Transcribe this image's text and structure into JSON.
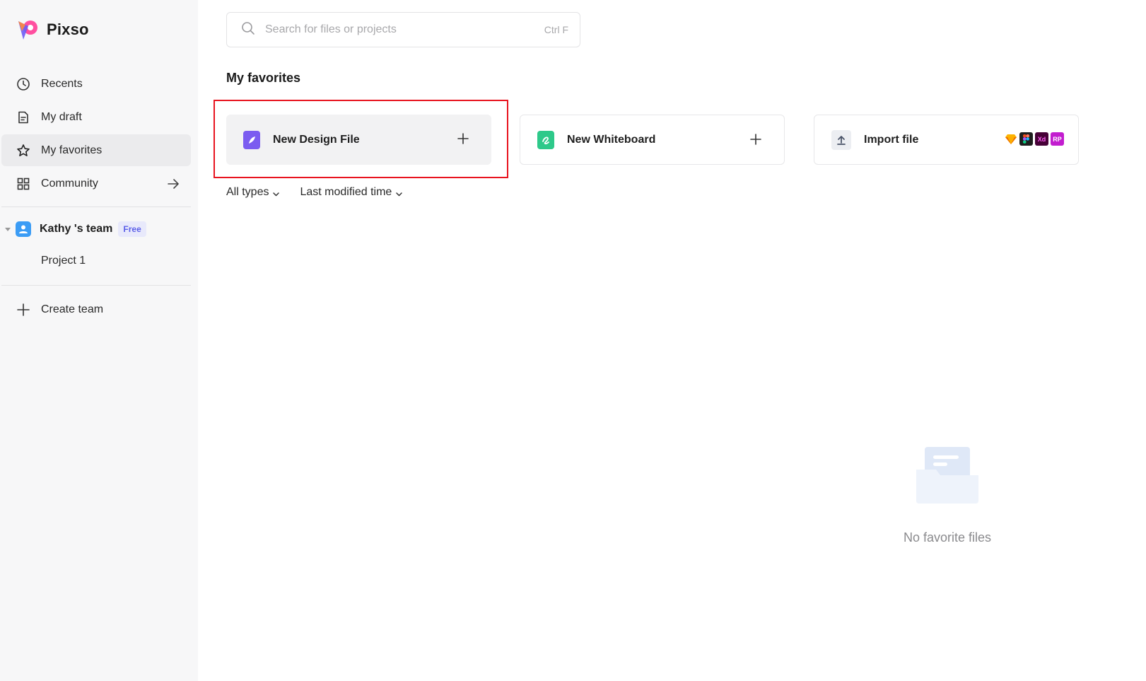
{
  "app": {
    "name": "Pixso"
  },
  "sidebar": {
    "nav": [
      {
        "label": "Recents",
        "icon": "clock-icon"
      },
      {
        "label": "My draft",
        "icon": "draft-document-icon"
      },
      {
        "label": "My favorites",
        "icon": "star-icon",
        "active": true
      },
      {
        "label": "Community",
        "icon": "grid-icon",
        "trailing_icon": "arrow-right-icon"
      }
    ],
    "team": {
      "name": "Kathy 's team",
      "badge": "Free",
      "projects": [
        {
          "label": "Project 1"
        }
      ]
    },
    "create_team_label": "Create team"
  },
  "search": {
    "placeholder": "Search for files or projects",
    "shortcut": "Ctrl F"
  },
  "main": {
    "section_title": "My favorites",
    "cards": [
      {
        "label": "New Design File",
        "icon": "design-file-icon",
        "action_icon": "plus-icon"
      },
      {
        "label": "New Whiteboard",
        "icon": "whiteboard-icon",
        "action_icon": "plus-icon"
      },
      {
        "label": "Import file",
        "icon": "upload-icon",
        "formats": [
          "Sketch",
          "Figma",
          "Xd",
          "RP"
        ]
      }
    ],
    "filters": [
      {
        "label": "All types"
      },
      {
        "label": "Last modified time"
      }
    ],
    "empty_state": {
      "text": "No favorite files"
    }
  },
  "colors": {
    "highlight": "#e8141f",
    "accent": "#5b5fe8",
    "design_icon": "#7b5cf0",
    "whiteboard_icon": "#2ec98a",
    "team_avatar": "#3b9cf5"
  }
}
